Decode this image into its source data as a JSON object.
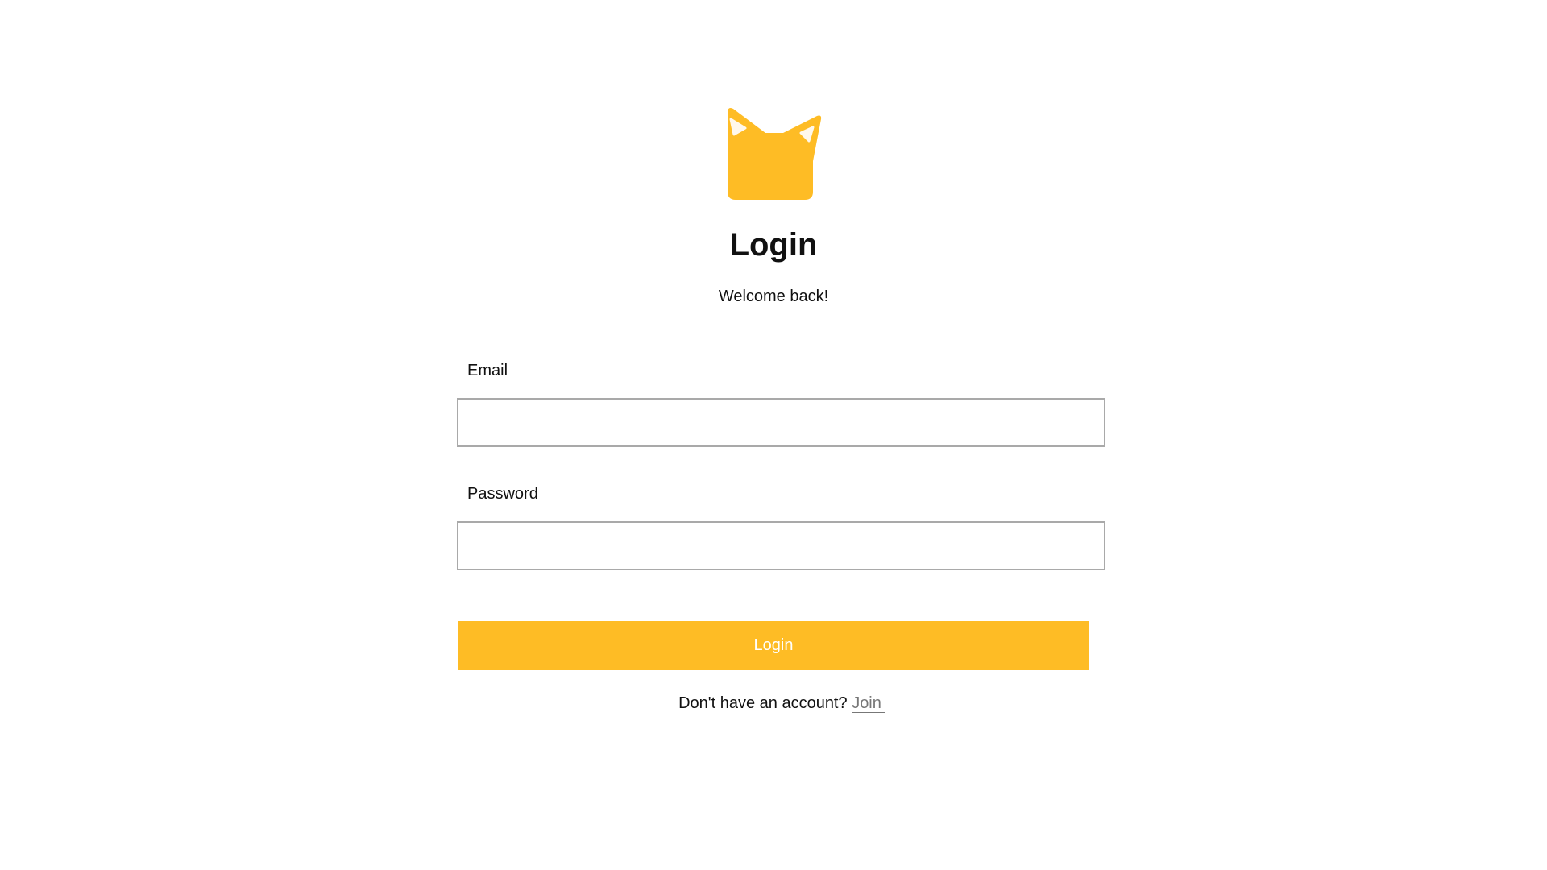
{
  "colors": {
    "accent": "#FEBC25",
    "logo_ear_inner": "#FFF8EC"
  },
  "logo": {
    "icon": "cat-head-logo"
  },
  "header": {
    "title": "Login",
    "subtitle": "Welcome back!"
  },
  "form": {
    "email": {
      "label": "Email",
      "value": "",
      "placeholder": ""
    },
    "password": {
      "label": "Password",
      "value": "",
      "placeholder": ""
    },
    "submit_label": "Login"
  },
  "footer": {
    "prompt": "Don't have an account?",
    "link_label": "Join"
  }
}
